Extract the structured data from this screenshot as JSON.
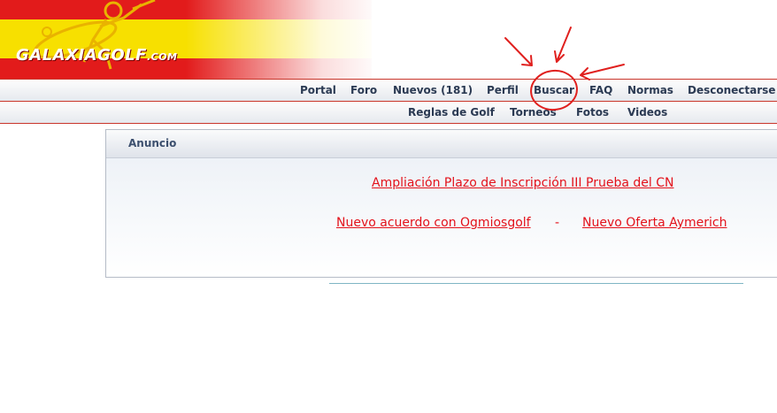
{
  "logo": {
    "text_main": "GALAXIAGOLF",
    "text_suffix": ".COM"
  },
  "nav_primary": [
    {
      "label": "Portal"
    },
    {
      "label": "Foro"
    },
    {
      "label": "Nuevos (181)"
    },
    {
      "label": "Perfil"
    },
    {
      "label": "Buscar"
    },
    {
      "label": "FAQ"
    },
    {
      "label": "Normas"
    },
    {
      "label": "Desconectarse"
    }
  ],
  "nav_secondary": [
    {
      "label": "Reglas de Golf"
    },
    {
      "label": "Torneos"
    },
    {
      "label": "Fotos"
    },
    {
      "label": "Videos"
    }
  ],
  "announcement": {
    "title": "Anuncio",
    "link1": "Ampliación Plazo de Inscripción III Prueba del CN",
    "link2": "Nuevo acuerdo con Ogmiosgolf ",
    "separator": "-",
    "link3": "Nuevo Oferta Aymerich"
  },
  "colors": {
    "accent_red": "#e3111a",
    "nav_text": "#2b3a53",
    "annotation_red": "#e0201e"
  }
}
